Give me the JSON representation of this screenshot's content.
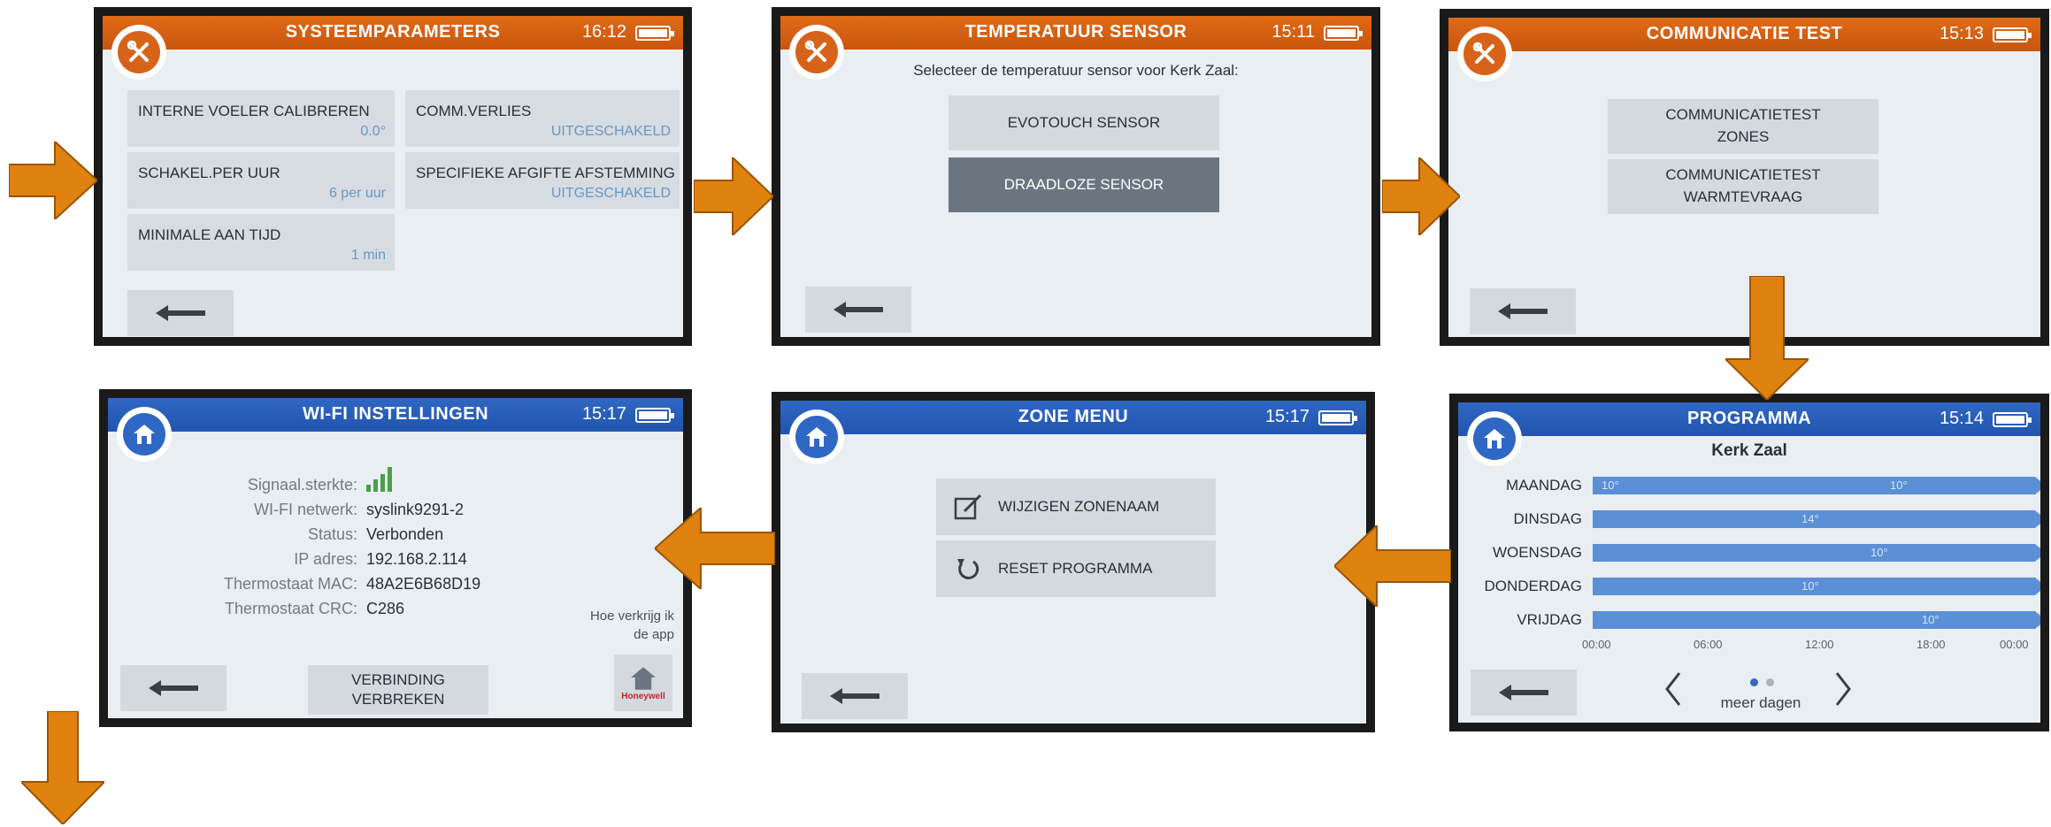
{
  "colors": {
    "orange_bar": "#c9560e",
    "blue_bar": "#2155ae",
    "flow_arrow": "#e0820f",
    "schedule_bar": "#5b8fd6",
    "value_text": "#6a97c8",
    "signal": "#4aa04a"
  },
  "screen1": {
    "title": "SYSTEEMPARAMETERS",
    "time": "16:12",
    "badge_icon": "tools-icon",
    "tiles": [
      {
        "label": "INTERNE VOELER CALIBREREN",
        "value": "0.0°"
      },
      {
        "label": "COMM.VERLIES",
        "value": "UITGESCHAKELD"
      },
      {
        "label": "SCHAKEL.PER UUR",
        "value": "6 per uur"
      },
      {
        "label": "SPECIFIEKE AFGIFTE AFSTEMMING",
        "value": "UITGESCHAKELD"
      },
      {
        "label": "MINIMALE AAN TIJD",
        "value": "1 min"
      }
    ]
  },
  "screen2": {
    "title": "TEMPERATUUR SENSOR",
    "time": "15:11",
    "badge_icon": "tools-icon",
    "prompt": "Selecteer de temperatuur sensor voor Kerk Zaal:",
    "options": [
      "EVOTOUCH SENSOR",
      "DRAADLOZE SENSOR"
    ],
    "selected": "DRAADLOZE SENSOR"
  },
  "screen3": {
    "title": "COMMUNICATIE TEST",
    "time": "15:13",
    "badge_icon": "tools-icon",
    "buttons": [
      {
        "line1": "COMMUNICATIETEST",
        "line2": "ZONES"
      },
      {
        "line1": "COMMUNICATIETEST",
        "line2": "WARMTEVRAAG"
      }
    ]
  },
  "screen4": {
    "title": "WI-FI INSTELLINGEN",
    "time": "15:17",
    "badge_icon": "home-icon",
    "rows": [
      {
        "label": "Signaal.sterkte:",
        "value": ""
      },
      {
        "label": "WI-FI netwerk:",
        "value": "syslink9291-2"
      },
      {
        "label": "Status:",
        "value": "Verbonden"
      },
      {
        "label": "IP adres:",
        "value": "192.168.2.114"
      },
      {
        "label": "Thermostaat MAC:",
        "value": "48A2E6B68D19"
      },
      {
        "label": "Thermostaat CRC:",
        "value": "C286"
      }
    ],
    "signal_bars": 4,
    "disconnect_line1": "VERBINDING",
    "disconnect_line2": "VERBREKEN",
    "app_hint_line1": "Hoe verkrijg ik",
    "app_hint_line2": "de app",
    "brand": "Honeywell"
  },
  "screen5": {
    "title": "ZONE MENU",
    "time": "15:17",
    "badge_icon": "home-icon",
    "buttons": [
      {
        "label": "WIJZIGEN ZONENAAM",
        "icon": "edit-icon"
      },
      {
        "label": "RESET PROGRAMMA",
        "icon": "reset-icon"
      }
    ]
  },
  "screen6": {
    "title": "PROGRAMMA",
    "time": "15:14",
    "badge_icon": "home-icon",
    "zone": "Kerk Zaal",
    "days": [
      {
        "name": "MAANDAG",
        "segments": [
          "10°",
          "10°"
        ]
      },
      {
        "name": "DINSDAG",
        "segments": [
          "14°"
        ]
      },
      {
        "name": "WOENSDAG",
        "segments": [
          "10°"
        ]
      },
      {
        "name": "DONDERDAG",
        "segments": [
          "10°"
        ]
      },
      {
        "name": "VRIJDAG",
        "segments": [
          "10°"
        ]
      }
    ],
    "ticks": [
      "00:00",
      "06:00",
      "12:00",
      "18:00",
      "00:00"
    ],
    "more_days": "meer dagen",
    "page": 1,
    "pages": 2
  }
}
